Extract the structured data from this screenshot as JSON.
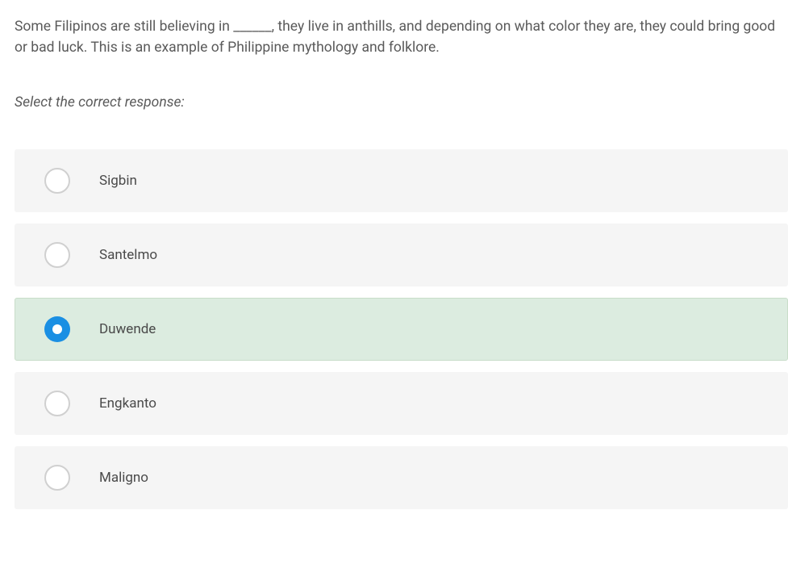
{
  "question": "Some Filipinos are still believing in ______, they live in anthills, and depending on what color they are, they could bring good or bad luck. This is an example of Philippine mythology and folklore.",
  "instruction": "Select the correct response:",
  "options": [
    {
      "label": "Sigbin",
      "selected": false
    },
    {
      "label": "Santelmo",
      "selected": false
    },
    {
      "label": "Duwende",
      "selected": true
    },
    {
      "label": "Engkanto",
      "selected": false
    },
    {
      "label": "Maligno",
      "selected": false
    }
  ]
}
